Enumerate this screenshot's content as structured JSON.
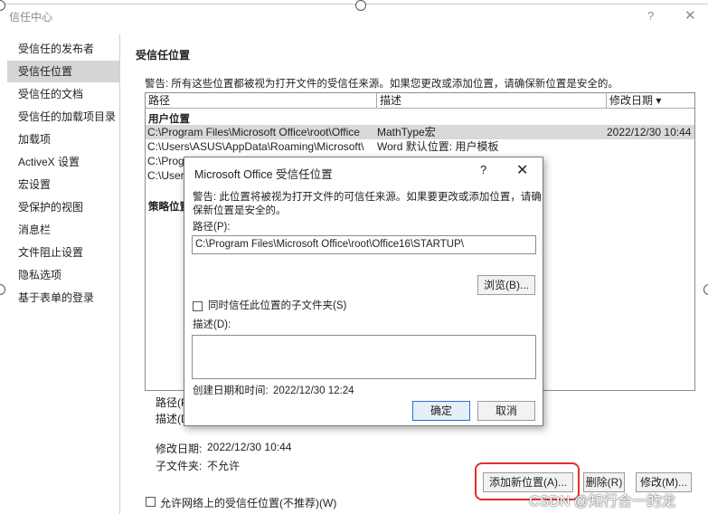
{
  "window": {
    "title": "信任中心",
    "help": "?",
    "close": "✕"
  },
  "sidebar": {
    "items": [
      {
        "label": "受信任的发布者"
      },
      {
        "label": "受信任位置"
      },
      {
        "label": "受信任的文档"
      },
      {
        "label": "受信任的加载项目录"
      },
      {
        "label": "加载项"
      },
      {
        "label": "ActiveX 设置"
      },
      {
        "label": "宏设置"
      },
      {
        "label": "受保护的视图"
      },
      {
        "label": "消息栏"
      },
      {
        "label": "文件阻止设置"
      },
      {
        "label": "隐私选项"
      },
      {
        "label": "基于表单的登录"
      }
    ],
    "selected_index": 1
  },
  "main": {
    "title": "受信任位置",
    "warning": "警告: 所有这些位置都被视为打开文件的受信任来源。如果您更改或添加位置，请确保新位置是安全的。",
    "columns": {
      "path": "路径",
      "description": "描述",
      "date": "修改日期 ▾"
    },
    "user_group": "用户位置",
    "policy_group": "策略位置",
    "rows": [
      {
        "path": "C:\\Program Files\\Microsoft Office\\root\\Office",
        "description": "MathType宏",
        "date": "2022/12/30 10:44"
      },
      {
        "path": "C:\\Users\\ASUS\\AppData\\Roaming\\Microsoft\\",
        "description": "Word 默认位置: 用户模板",
        "date": ""
      },
      {
        "path": "C:\\Progr",
        "description": "",
        "date": ""
      },
      {
        "path": "C:\\Users",
        "description": "",
        "date": ""
      }
    ],
    "details": {
      "path_label": "路径(P)",
      "desc_label": "描述(D",
      "modified_label": "修改日期:",
      "modified_value": "2022/12/30 10:44",
      "subfolders_label": "子文件夹:",
      "subfolders_value": "不允许"
    },
    "buttons": {
      "add": "添加新位置(A)...",
      "remove": "删除(R)",
      "modify": "修改(M)..."
    },
    "allow_network": "允许网络上的受信任位置(不推荐)(W)"
  },
  "dialog": {
    "title": "Microsoft Office 受信任位置",
    "help": "?",
    "close": "✕",
    "warning_line1": "警告: 此位置将被视为打开文件的可信任来源。如果要更改或添加位置，请确",
    "warning_line2": "保新位置是安全的。",
    "path_label": "路径(P):",
    "path_value": "C:\\Program Files\\Microsoft Office\\root\\Office16\\STARTUP\\",
    "browse": "浏览(B)...",
    "subfolder_checkbox": "同时信任此位置的子文件夹(S)",
    "desc_label": "描述(D):",
    "desc_value": "",
    "created_label": "创建日期和时间:",
    "created_value": "2022/12/30 12:24",
    "ok": "确定",
    "cancel": "取消"
  },
  "watermark": "CSDN @知行合一的龙"
}
